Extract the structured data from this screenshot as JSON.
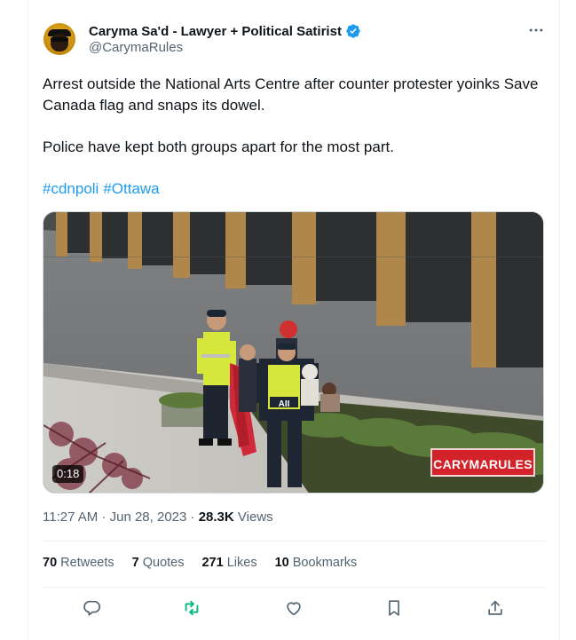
{
  "author": {
    "display_name": "Caryma Sa'd - Lawyer + Political Satirist",
    "handle": "@CarymaRules",
    "verified": true
  },
  "tweet": {
    "line1": "Arrest outside the National Arts Centre after counter protester yoinks Save Canada flag and snaps its dowel.",
    "line2": "Police have kept both groups apart for the most part.",
    "hashtags": [
      "#cdnpoli",
      "#Ottawa"
    ]
  },
  "media": {
    "duration": "0:18",
    "watermark": "CARYMARULES",
    "vest_text": "AII"
  },
  "meta": {
    "time": "11:27 AM",
    "date": "Jun 28, 2023",
    "separator": "·",
    "views_count": "28.3K",
    "views_label": "Views"
  },
  "stats": {
    "retweets": {
      "count": "70",
      "label": "Retweets"
    },
    "quotes": {
      "count": "7",
      "label": "Quotes"
    },
    "likes": {
      "count": "271",
      "label": "Likes"
    },
    "bookmarks": {
      "count": "10",
      "label": "Bookmarks"
    }
  },
  "icons": {
    "verified": "verified-badge-icon",
    "more": "more-horizontal-icon",
    "reply": "reply-icon",
    "retweet": "retweet-icon",
    "like": "heart-icon",
    "bookmark": "bookmark-icon",
    "share": "share-icon"
  },
  "colors": {
    "accent": "#1d9bf0",
    "retweet_green": "#00ba7c",
    "secondary_text": "#536471",
    "watermark_red": "#d2232a"
  }
}
